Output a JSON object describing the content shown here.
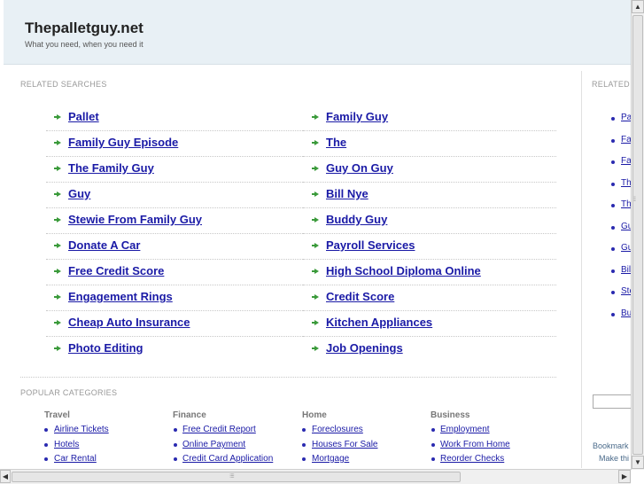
{
  "header": {
    "title": "Thepalletguy.net",
    "tagline": "What you need, when you need it"
  },
  "related": {
    "label": "RELATED SEARCHES",
    "left": [
      "Pallet",
      "Family Guy Episode",
      "The Family Guy",
      "Guy",
      "Stewie From Family Guy",
      "Donate A Car",
      "Free Credit Score",
      "Engagement Rings",
      "Cheap Auto Insurance",
      "Photo Editing"
    ],
    "right": [
      "Family Guy",
      "The",
      "Guy On Guy",
      "Bill Nye",
      "Buddy Guy",
      "Payroll Services",
      "High School Diploma Online",
      "Credit Score",
      "Kitchen Appliances",
      "Job Openings"
    ]
  },
  "popular": {
    "label": "POPULAR CATEGORIES",
    "columns": [
      {
        "heading": "Travel",
        "links": [
          "Airline Tickets",
          "Hotels",
          "Car Rental"
        ]
      },
      {
        "heading": "Finance",
        "links": [
          "Free Credit Report",
          "Online Payment",
          "Credit Card Application"
        ]
      },
      {
        "heading": "Home",
        "links": [
          "Foreclosures",
          "Houses For Sale",
          "Mortgage"
        ]
      },
      {
        "heading": "Business",
        "links": [
          "Employment",
          "Work From Home",
          "Reorder Checks"
        ]
      }
    ]
  },
  "right_panel": {
    "label": "RELATED",
    "links": [
      "Pa",
      "Fa",
      "Fa",
      "Th",
      "Th",
      "Gu",
      "Gu",
      "Bill",
      "Ste",
      "Bu"
    ],
    "bookmark": "Bookmark",
    "make": "Make thi"
  },
  "colors": {
    "link": "#1a1aa6",
    "arrow": "#3a9a3a",
    "header_bg": "#e8f0f5"
  }
}
